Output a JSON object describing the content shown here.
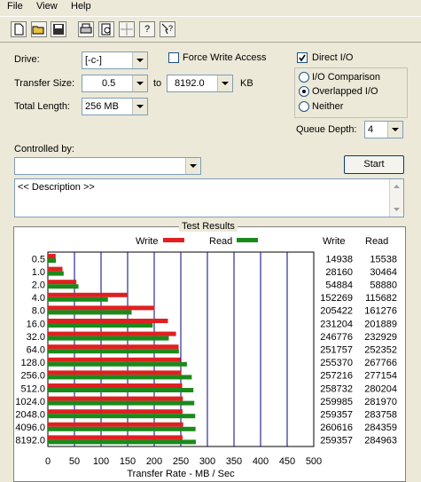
{
  "menu": {
    "file": "File",
    "view": "View",
    "help": "Help"
  },
  "toolbar": {
    "icons": [
      "new-icon",
      "open-icon",
      "save-icon",
      "print-icon",
      "print-preview-icon",
      "move-icon",
      "help-icon",
      "context-help-icon"
    ]
  },
  "form": {
    "drive_label": "Drive:",
    "drive_value": "[-c-]",
    "transfer_label": "Transfer Size:",
    "transfer_from": "0.5",
    "to_label": "to",
    "transfer_to": "8192.0",
    "kb_label": "KB",
    "total_label": "Total Length:",
    "total_value": "256 MB",
    "force_write_label": "Force Write Access",
    "force_write_checked": false,
    "direct_io_label": "Direct I/O",
    "direct_io_checked": true,
    "io_comparison_label": "I/O Comparison",
    "overlapped_label": "Overlapped I/O",
    "neither_label": "Neither",
    "selected_mode": "Overlapped I/O",
    "queue_label": "Queue Depth:",
    "queue_value": "4",
    "controlled_label": "Controlled by:",
    "controlled_value": "",
    "start_label": "Start",
    "description": "<< Description >>"
  },
  "results": {
    "title": "Test Results",
    "legend_write": "Write",
    "legend_read": "Read",
    "col_write": "Write",
    "col_read": "Read"
  },
  "chart_data": {
    "type": "bar",
    "orientation": "horizontal",
    "categories": [
      "0.5",
      "1.0",
      "2.0",
      "4.0",
      "8.0",
      "16.0",
      "32.0",
      "64.0",
      "128.0",
      "256.0",
      "512.0",
      "1024.0",
      "2048.0",
      "4096.0",
      "8192.0"
    ],
    "series": [
      {
        "name": "Write",
        "color": "#e02020",
        "values_kb": [
          14938,
          28160,
          54884,
          152269,
          205422,
          231204,
          246776,
          251757,
          255370,
          257216,
          258732,
          259985,
          259357,
          260616,
          259357
        ]
      },
      {
        "name": "Read",
        "color": "#1a8a1a",
        "values_kb": [
          15538,
          30464,
          58880,
          115682,
          161276,
          201889,
          232929,
          252352,
          267766,
          277154,
          280204,
          281970,
          283758,
          284359,
          284963
        ]
      }
    ],
    "xlabel": "Transfer Rate - MB / Sec",
    "xticks": [
      "0",
      "50",
      "100",
      "150",
      "200",
      "250",
      "300",
      "350",
      "400",
      "450",
      "500"
    ],
    "xlim": [
      0,
      500
    ]
  },
  "colors": {
    "write": "#e02020",
    "read": "#1a8a1a",
    "grid": "#000080"
  }
}
